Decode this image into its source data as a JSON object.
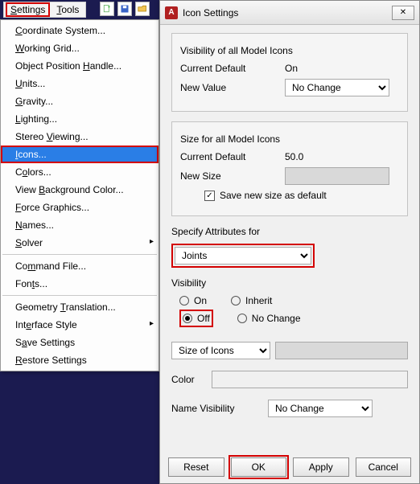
{
  "menubar": {
    "settings": "Settings",
    "tools": "Tools"
  },
  "dropdown": {
    "coord": "Coordinate System...",
    "wgrid": "Working Grid...",
    "oph": "Object Position Handle...",
    "units": "Units...",
    "gravity": "Gravity...",
    "lighting": "Lighting...",
    "stereo": "Stereo Viewing...",
    "icons": "Icons...",
    "colors": "Colors...",
    "vbg": "View Background Color...",
    "fg": "Force Graphics...",
    "names": "Names...",
    "solver": "Solver",
    "cfile": "Command File...",
    "fonts": "Fonts...",
    "gtrans": "Geometry Translation...",
    "istyle": "Interface Style",
    "save": "Save Settings",
    "restore": "Restore Settings"
  },
  "dialog": {
    "title": "Icon Settings",
    "vis_all": "Visibility of all Model Icons",
    "cur_def": "Current Default",
    "cur_def_val_vis": "On",
    "new_val": "New Value",
    "new_val_sel": "No Change",
    "size_all": "Size for all Model Icons",
    "cur_def_val_size": "50.0",
    "new_size": "New Size",
    "save_newsize": "Save new size as default",
    "spec_attr": "Specify Attributes for",
    "spec_attr_sel": "Joints",
    "visibility": "Visibility",
    "opt_on": "On",
    "opt_off": "Off",
    "opt_inherit": "Inherit",
    "opt_nochange": "No Change",
    "size_icons": "Size of Icons",
    "color": "Color",
    "name_vis": "Name Visibility",
    "name_vis_sel": "No Change",
    "btn_reset": "Reset",
    "btn_ok": "OK",
    "btn_apply": "Apply",
    "btn_cancel": "Cancel"
  }
}
